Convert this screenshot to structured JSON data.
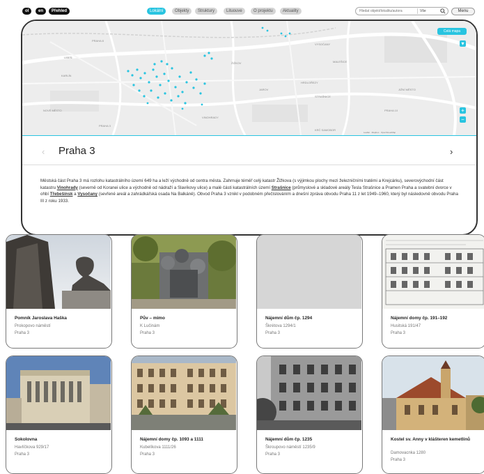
{
  "topbar": {
    "languages": [
      "ol",
      "en",
      "Přehled"
    ],
    "nav": [
      {
        "label": "Lokální",
        "active": true
      },
      {
        "label": "Objekty",
        "active": false
      },
      {
        "label": "Struktury",
        "active": false
      },
      {
        "label": "Lituouve",
        "active": false
      },
      {
        "label": "O projektu",
        "active": false
      },
      {
        "label": "Aktuality",
        "active": false
      }
    ],
    "search_placeholder": "Hledat objekt/lokalitu/autora",
    "search_scope": "Vše",
    "menu_label": "Menu"
  },
  "map": {
    "button_label": "Celá mapa",
    "labels": [
      "LIBEŇ",
      "PRAHA 8",
      "KARLÍN",
      "ŽIŽKOV",
      "VINOHRADY",
      "STRAŠNICE",
      "MALEŠICE",
      "HRDLOŘEZY",
      "PRAHA 3",
      "JAROV",
      "VYSOČANY",
      "NOVÉ MĚSTO",
      "PRAHA 10",
      "KRČ SAMOBOR",
      "JIŽNÍ MĚSTO"
    ],
    "attribution": "Leaflet · Mapbox · OpenStreetMap"
  },
  "district": {
    "title": "Praha 3",
    "desc_1": "Městská část Praha 3 má rozlohu katastrálního území 649 ha a leží východně od centra města. Zahrnuje téměř celý katastr Žižkova (s výjimkou plochy mezi železničními tratěmi a Krejcárku), severovýchodní část katastru ",
    "desc_link_1": "Vinohrady",
    "desc_2": " (severně od Koranei ulice a východně od nádraží a Slavíkovy ulice) a malé části katastrálních území ",
    "desc_link_2": "Strašnice",
    "desc_3": " (průmyslové a skladové areály Tesla Strašnice a Pramen Praha a svatební dvorce v ohbí ",
    "desc_link_3": "Třebešínsk",
    "desc_4": " a ",
    "desc_link_4": "Vysočany",
    "desc_5": " (sevřené areál a zahrádkářská osada Na Balkáně). Obvod Praha 3 vznikl v podobném přečíslováním a dnešní zpráva obvodu Praha 11 z let 1949–1960, který byl následovně obvodu Praha III z roku 1933."
  },
  "cards": [
    {
      "title": "Pomník Jaroslava Haška",
      "line2": "Prokopovo náměstí",
      "line3": "Praha 3"
    },
    {
      "title": "Pův – mimo",
      "line2": "K Lučinám",
      "line3": "Praha 3"
    },
    {
      "title": "Nájemní dům čp. 1294",
      "line2": "Škrétova 1294/1",
      "line3": "Praha 3"
    },
    {
      "title": "Nájemní domy čp. 191–192",
      "line2": "Husitská 191/47",
      "line3": "Praha 3"
    },
    {
      "title": "Sokolovna",
      "line2": "Havlíčkova 929/17",
      "line3": "Praha 3"
    },
    {
      "title": "Nájemní domy čp. 1093 a 1111",
      "line2": "Kubelíkova 1111/26",
      "line3": "Praha 3"
    },
    {
      "title": "Nájemní dům čp. 1235",
      "line2": "Škroupovo náměstí 1235/9",
      "line3": "Praha 3"
    },
    {
      "title": "Kostel sv. Anny v klášteren kemetlínů",
      "line2": "Damovacnka 1280",
      "line3": "Praha 3"
    }
  ],
  "colors": {
    "accent": "#29c4e0",
    "border": "#333333"
  }
}
